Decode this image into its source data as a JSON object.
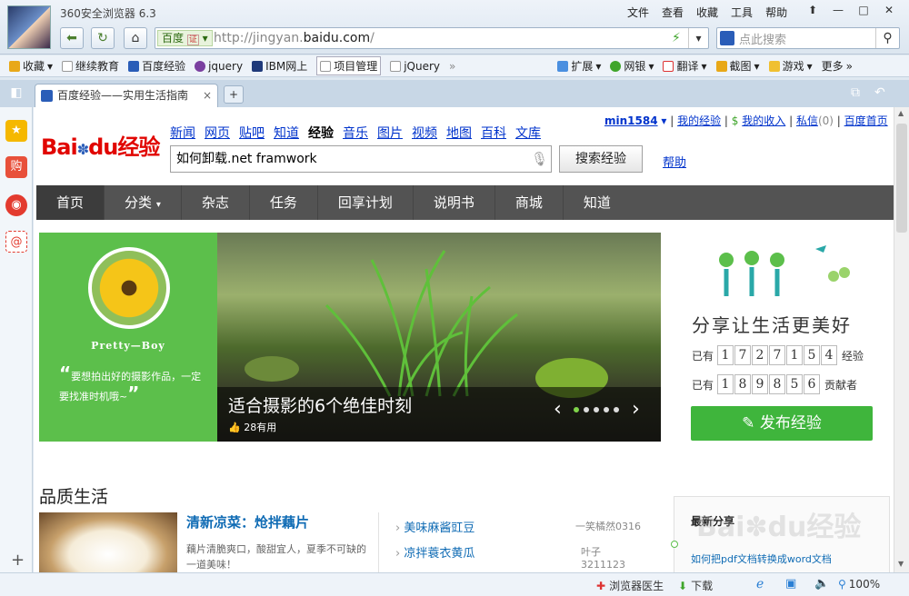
{
  "browser": {
    "app_title": "360安全浏览器 6.3",
    "menus": [
      "文件",
      "查看",
      "收藏",
      "工具",
      "帮助"
    ],
    "address_engine": "百度",
    "address_cert": "证",
    "url_prefix": "http://jingyan.",
    "url_domain": "baidu.com",
    "url_suffix": "/",
    "search_placeholder": "点此搜索",
    "bookmarks": [
      "收藏",
      "继续教育",
      "百度经验",
      "jquery",
      "IBM网上",
      "项目管理",
      "jQuery"
    ],
    "bookmarks_more": "»",
    "toolbar_items": [
      "扩展",
      "网银",
      "翻译",
      "截图",
      "游戏",
      "更多"
    ],
    "tab_title": "百度经验——实用生活指南",
    "tab_close": "×",
    "new_tab": "+",
    "sidebar_icons": [
      "star-icon",
      "shopping-icon",
      "weibo-icon",
      "email-icon"
    ],
    "sidebar_shop_label": "购",
    "sidebar_add": "+",
    "status_items": [
      "浏览器医生",
      "下载",
      "100%"
    ]
  },
  "page": {
    "logo_text_bai": "Bai",
    "logo_text_du": "du",
    "logo_text_jy": "经验",
    "top_nav": [
      "新闻",
      "网页",
      "贴吧",
      "知道",
      "经验",
      "音乐",
      "图片",
      "视频",
      "地图",
      "百科",
      "文库"
    ],
    "user_links": [
      "min1584",
      "我的经验",
      "我的收入",
      "私信",
      "(0)",
      "百度首页"
    ],
    "search_value": "如何卸载.net framwork",
    "search_button": "搜索经验",
    "help_link": "帮助",
    "main_nav": [
      "首页",
      "分类",
      "杂志",
      "任务",
      "回享计划",
      "说明书",
      "商城",
      "知道"
    ],
    "hero": {
      "user_name": "Pretty—Boy",
      "quote": "要想拍出好的摄影作品，一定要找准时机哦~",
      "caption": "适合摄影的6个绝佳时刻",
      "likes": "28有用",
      "slogan": "分享让生活更美好",
      "count_prefix": "已有",
      "experience_digits": [
        "1",
        "7",
        "2",
        "7",
        "1",
        "5",
        "4"
      ],
      "experience_label": "经验",
      "contributor_digits": [
        "1",
        "8",
        "9",
        "8",
        "5",
        "6"
      ],
      "contributor_label": "贡献者",
      "publish_button": "发布经验"
    },
    "quality": {
      "title": "品质生活",
      "feature_title": "清新凉菜：炝拌藕片",
      "feature_desc": "藕片清脆爽口，酸甜宜人，夏季不可缺的一道美味！",
      "list": [
        {
          "title": "美味麻酱豇豆",
          "author": "一笑橘然0316"
        },
        {
          "title": "凉拌蓑衣黄瓜",
          "author": "叶子3211123"
        }
      ],
      "latest_title": "最新分享",
      "latest_item": "如何把pdf文档转换成word文档"
    }
  }
}
